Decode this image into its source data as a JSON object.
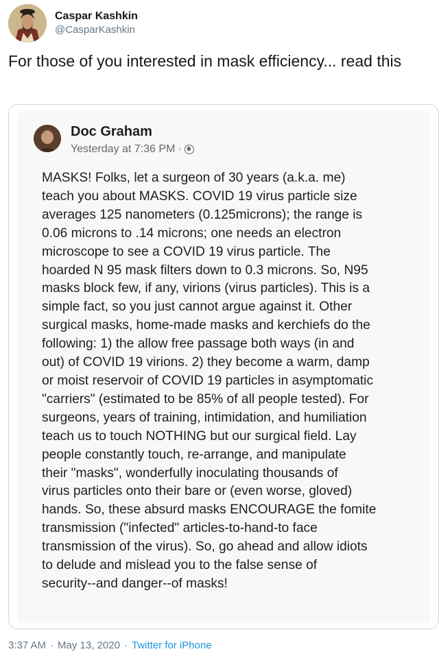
{
  "tweet": {
    "author": {
      "display_name": "Caspar Kashkin",
      "handle": "@CasparKashkin",
      "avatar_icon": "portrait-avatar"
    },
    "text": "For those of you interested in mask efficiency... read this",
    "footer": {
      "time": "3:37 AM",
      "date": "May 13, 2020",
      "separator": "·",
      "source": "Twitter for iPhone"
    }
  },
  "embedded_post": {
    "author_name": "Doc Graham",
    "timestamp": "Yesterday at 7:36 PM",
    "separator": "·",
    "privacy_icon": "globe-icon",
    "body_lines": [
      "MASKS! Folks, let a surgeon of 30 years (a.k.a. me)",
      "teach you about MASKS. COVID 19 virus particle size",
      "averages 125 nanometers (0.125microns); the range is",
      "0.06 microns to .14 microns; one needs an electron",
      "microscope to see a COVID 19 virus particle.  The",
      "hoarded N 95 mask filters down to 0.3 microns. So, N95",
      "masks block few, if any, virions (virus particles). This is a",
      "simple fact, so you just cannot argue against it. Other",
      "surgical masks, home-made masks and kerchiefs do the",
      "following: 1) the allow free passage both ways (in and",
      "out) of COVID 19 virions.  2) they become a warm, damp",
      "or moist reservoir of COVID 19 particles in asymptomatic",
      "\"carriers\" (estimated to be 85% of all people tested). For",
      "surgeons, years of training, intimidation, and humiliation",
      "teach us to touch NOTHING but our surgical field. Lay",
      "people constantly touch, re-arrange, and manipulate",
      "their \"masks\", wonderfully inoculating thousands of",
      "virus particles onto their bare or (even worse, gloved)",
      "hands. So, these absurd masks ENCOURAGE the fomite",
      "transmission (\"infected\" articles-to-hand-to face",
      "transmission of the virus). So, go ahead and allow idiots",
      "to delude and mislead you to the false sense of",
      "security--and danger--of masks!"
    ]
  },
  "colors": {
    "primary_text": "#14171a",
    "secondary_text": "#657786",
    "link": "#1b95e0",
    "card_border": "#cfd9de"
  }
}
